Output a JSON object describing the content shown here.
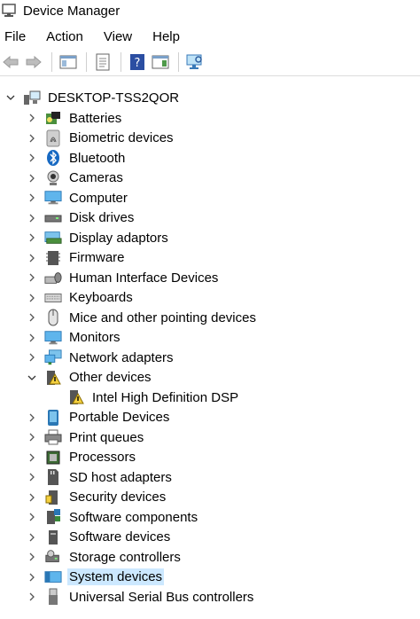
{
  "window": {
    "title": "Device Manager"
  },
  "menu": [
    "File",
    "Action",
    "View",
    "Help"
  ],
  "tree": {
    "root": "DESKTOP-TSS2QOR",
    "items": [
      {
        "label": "Batteries",
        "icon": "battery-icon"
      },
      {
        "label": "Biometric devices",
        "icon": "fingerprint-icon"
      },
      {
        "label": "Bluetooth",
        "icon": "bluetooth-icon"
      },
      {
        "label": "Cameras",
        "icon": "camera-icon"
      },
      {
        "label": "Computer",
        "icon": "computer-icon"
      },
      {
        "label": "Disk drives",
        "icon": "disk-drive-icon"
      },
      {
        "label": "Display adaptors",
        "icon": "display-adapter-icon"
      },
      {
        "label": "Firmware",
        "icon": "firmware-icon"
      },
      {
        "label": "Human Interface Devices",
        "icon": "hid-icon"
      },
      {
        "label": "Keyboards",
        "icon": "keyboard-icon"
      },
      {
        "label": "Mice and other pointing devices",
        "icon": "mouse-icon"
      },
      {
        "label": "Monitors",
        "icon": "monitor-icon"
      },
      {
        "label": "Network adapters",
        "icon": "network-icon"
      },
      {
        "label": "Other devices",
        "icon": "other-devices-icon",
        "expanded": true,
        "children": [
          {
            "label": "Intel High Definition DSP",
            "icon": "warning-device-icon"
          }
        ]
      },
      {
        "label": "Portable Devices",
        "icon": "portable-device-icon"
      },
      {
        "label": "Print queues",
        "icon": "printer-icon"
      },
      {
        "label": "Processors",
        "icon": "processor-icon"
      },
      {
        "label": "SD host adapters",
        "icon": "sd-card-icon"
      },
      {
        "label": "Security devices",
        "icon": "security-icon"
      },
      {
        "label": "Software components",
        "icon": "software-components-icon"
      },
      {
        "label": "Software devices",
        "icon": "software-devices-icon"
      },
      {
        "label": "Storage controllers",
        "icon": "storage-controller-icon"
      },
      {
        "label": "System devices",
        "icon": "system-devices-icon",
        "selected": true
      },
      {
        "label": "Universal Serial Bus controllers",
        "icon": "usb-icon"
      }
    ]
  }
}
